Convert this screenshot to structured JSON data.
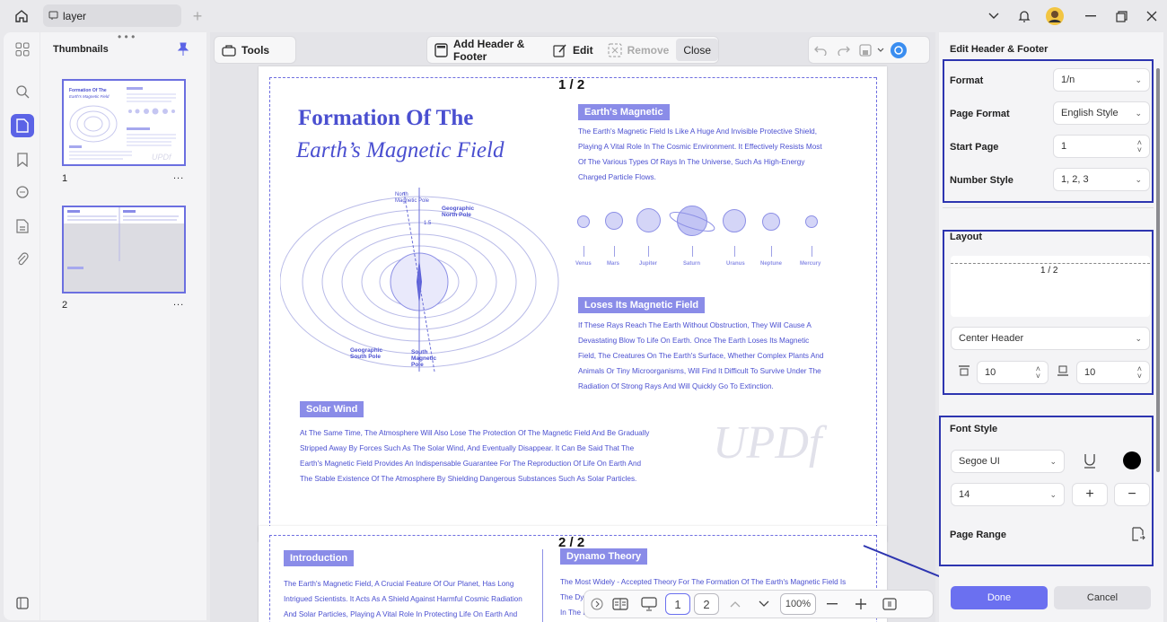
{
  "titlebar": {
    "tab_label": "layer"
  },
  "thumbnails": {
    "title": "Thumbnails",
    "pages": [
      {
        "label": "1"
      },
      {
        "label": "2"
      }
    ],
    "more": "..."
  },
  "toolbar": {
    "tools": "Tools",
    "add_header_footer": "Add Header & Footer",
    "edit": "Edit",
    "remove": "Remove",
    "close": "Close"
  },
  "page1": {
    "header_num": "1 / 2",
    "title_line1": "Formation Of The",
    "title_line2": "Earth’s Magnetic Field",
    "tag_earth": "Earth's Magnetic",
    "earth_text": [
      "The Earth's Magnetic Field Is Like A Huge And Invisible Protective Shield,",
      "Playing A Vital Role In The Cosmic Environment. It Effectively Resists Most",
      "Of The Various Types Of Rays In The Universe, Such As High-Energy",
      "Charged Particle Flows."
    ],
    "planets": [
      "Venus",
      "Mars",
      "Jupiter",
      "Saturn",
      "Uranus",
      "Neptune",
      "Mercury"
    ],
    "tag_loses": "Loses Its Magnetic Field",
    "loses_text": [
      "If These Rays Reach The Earth Without Obstruction, They Will Cause A",
      "Devastating Blow To Life On Earth. Once The Earth Loses Its Magnetic",
      "Field, The Creatures On The Earth's Surface, Whether Complex Plants And",
      "Animals Or Tiny Microorganisms, Will Find It Difficult To Survive Under The",
      "Radiation Of Strong Rays And Will Quickly Go To Extinction."
    ],
    "tag_solar": "Solar Wind",
    "solar_text": [
      "At The Same Time, The Atmosphere Will Also Lose The Protection Of The Magnetic Field And Be Gradually",
      "Stripped Away By Forces Such As The Solar Wind, And Eventually Disappear. It Can Be Said That The",
      "Earth's Magnetic Field Provides An Indispensable Guarantee For The Reproduction Of Life On Earth And",
      "The Stable Existence Of The Atmosphere By Shielding Dangerous Substances Such As Solar Particles."
    ],
    "diagram": {
      "north_mag": "North\nMagnetic Pole",
      "geo_north": "Geographic\nNorth Pole",
      "geo_south": "Geographic\nSouth Pole",
      "south_mag": "South\nMagnetic\nPole",
      "angle": "1.5"
    },
    "watermark": "UPDf"
  },
  "page2": {
    "header_num": "2 / 2",
    "tag_intro": "Introduction",
    "intro_text": [
      "The Earth's Magnetic Field, A Crucial Feature Of Our Planet, Has Long",
      "Intrigued Scientists. It Acts As A Shield Against Harmful Cosmic Radiation",
      "And Solar Particles, Playing A Vital Role In Protecting Life On Earth And"
    ],
    "tag_dynamo": "Dynamo Theory",
    "dynamo_text": [
      "The Most Widely - Accepted Theory For The Formation Of The Earth's Magnetic Field Is",
      "The Dy",
      "In The E"
    ]
  },
  "bottomnav": {
    "page1": "1",
    "page2": "2",
    "zoom": "100%"
  },
  "panel": {
    "title": "Edit Header & Footer",
    "format_label": "Format",
    "format_value": "1/n",
    "page_format_label": "Page Format",
    "page_format_value": "English Style",
    "start_page_label": "Start Page",
    "start_page_value": "1",
    "number_style_label": "Number Style",
    "number_style_value": "1, 2, 3",
    "layout_label": "Layout",
    "layout_preview": "1 / 2",
    "position_value": "Center Header",
    "margin_top": "10",
    "margin_bottom": "10",
    "font_style_label": "Font Style",
    "font_value": "Segoe UI",
    "font_size": "14",
    "page_range_label": "Page Range",
    "done": "Done",
    "cancel": "Cancel"
  },
  "colors": {
    "accent": "#6b70f0",
    "page_text": "#4a4fd0",
    "highlight_box": "#2d35b0"
  }
}
